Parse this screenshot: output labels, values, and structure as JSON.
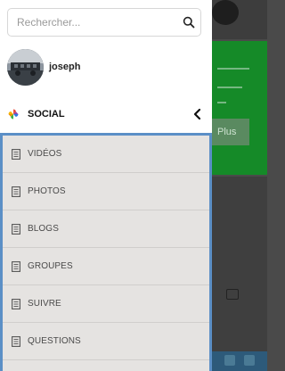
{
  "search": {
    "placeholder": "Rechercher..."
  },
  "user": {
    "name": "joseph"
  },
  "section": {
    "label": "SOCIAL"
  },
  "menu": {
    "items": [
      {
        "label": "VIDÉOS"
      },
      {
        "label": "PHOTOS"
      },
      {
        "label": "BLOGS"
      },
      {
        "label": "GROUPES"
      },
      {
        "label": "SUIVRE"
      },
      {
        "label": "QUESTIONS"
      }
    ]
  },
  "background": {
    "button_label": "Plus"
  },
  "colors": {
    "accent_border": "#5b8fc6",
    "background_green": "#158a28",
    "menu_bg": "#e5e3e1"
  },
  "icons": {
    "search": "search-icon",
    "social": "pinwheel-icon",
    "collapse": "chevron-left-icon",
    "menu_item": "document-icon"
  }
}
